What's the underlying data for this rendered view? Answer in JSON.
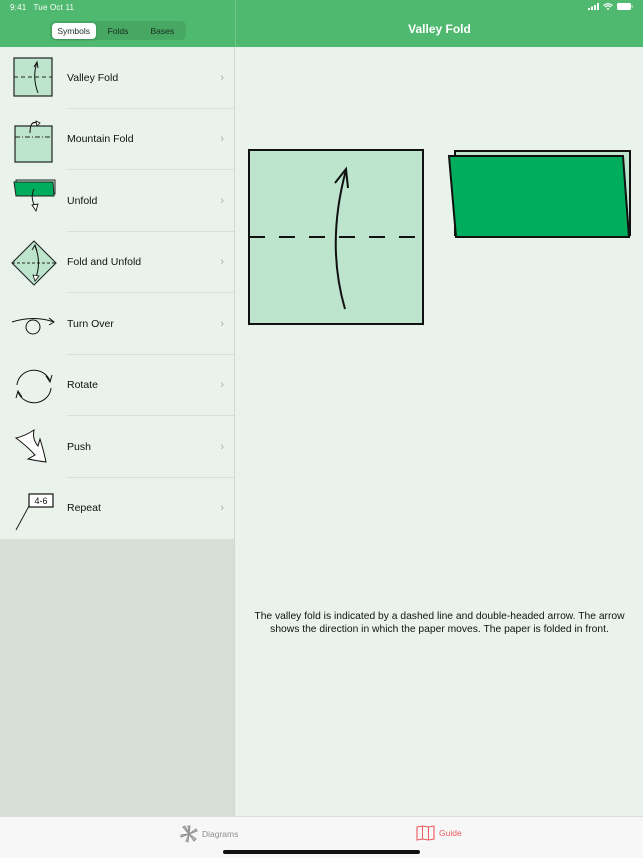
{
  "status_bar": {
    "time": "9:41",
    "date": "Tue Oct 11"
  },
  "segmented_control": {
    "options": [
      "Symbols",
      "Folds",
      "Bases"
    ],
    "selected": "Symbols"
  },
  "detail": {
    "title": "Valley Fold",
    "description": "The valley fold is indicated by a dashed line and double-headed arrow. The arrow shows the direction in which the paper moves. The paper is folded in front."
  },
  "sidebar": {
    "items": [
      {
        "label": "Valley Fold",
        "icon": "valley-fold-icon"
      },
      {
        "label": "Mountain Fold",
        "icon": "mountain-fold-icon"
      },
      {
        "label": "Unfold",
        "icon": "unfold-icon"
      },
      {
        "label": "Fold and Unfold",
        "icon": "fold-and-unfold-icon"
      },
      {
        "label": "Turn Over",
        "icon": "turn-over-icon"
      },
      {
        "label": "Rotate",
        "icon": "rotate-icon"
      },
      {
        "label": "Push",
        "icon": "push-icon"
      },
      {
        "label": "Repeat",
        "icon": "repeat-icon",
        "badge": "4-6"
      }
    ],
    "chevron": "›"
  },
  "tabbar": {
    "tabs": [
      {
        "label": "Diagrams",
        "icon": "flower-icon"
      },
      {
        "label": "Guide",
        "icon": "map-book-icon",
        "active": true
      }
    ]
  },
  "colors": {
    "header": "#4fb96f",
    "paper_light": "#bde5cd",
    "paper_dark": "#00ad5c",
    "background": "#e9f3ec",
    "active_tab": "#ea5a5f"
  }
}
